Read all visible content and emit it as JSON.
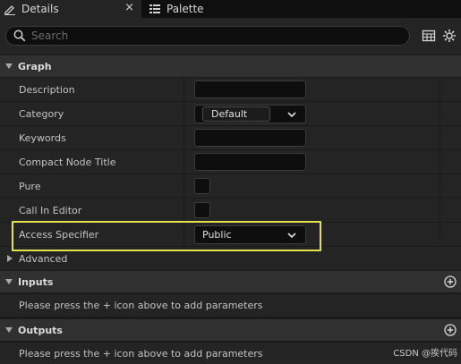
{
  "tabs": {
    "details_label": "Details",
    "close_glyph": "×",
    "palette_label": "Palette"
  },
  "search": {
    "placeholder": "Search"
  },
  "sections": {
    "graph": "Graph",
    "advanced": "Advanced",
    "inputs": "Inputs",
    "outputs": "Outputs"
  },
  "graph_rows": {
    "description": "Description",
    "category": "Category",
    "category_value": "Default",
    "keywords": "Keywords",
    "compact_node_title": "Compact Node Title",
    "pure": "Pure",
    "call_in_editor": "Call In Editor",
    "access_specifier": "Access Specifier",
    "access_specifier_value": "Public"
  },
  "inputs_message": "Please press the + icon above to add parameters",
  "outputs_message": "Please press the + icon above to add parameters",
  "watermark": "CSDN @挨代码",
  "colors": {
    "highlight": "#e5e04c",
    "panel": "#242424",
    "section": "#303030"
  },
  "icons": [
    "pencil-icon",
    "palette-icon",
    "search-icon",
    "table-view-icon",
    "gear-icon",
    "add-icon",
    "chevron-down-icon"
  ]
}
